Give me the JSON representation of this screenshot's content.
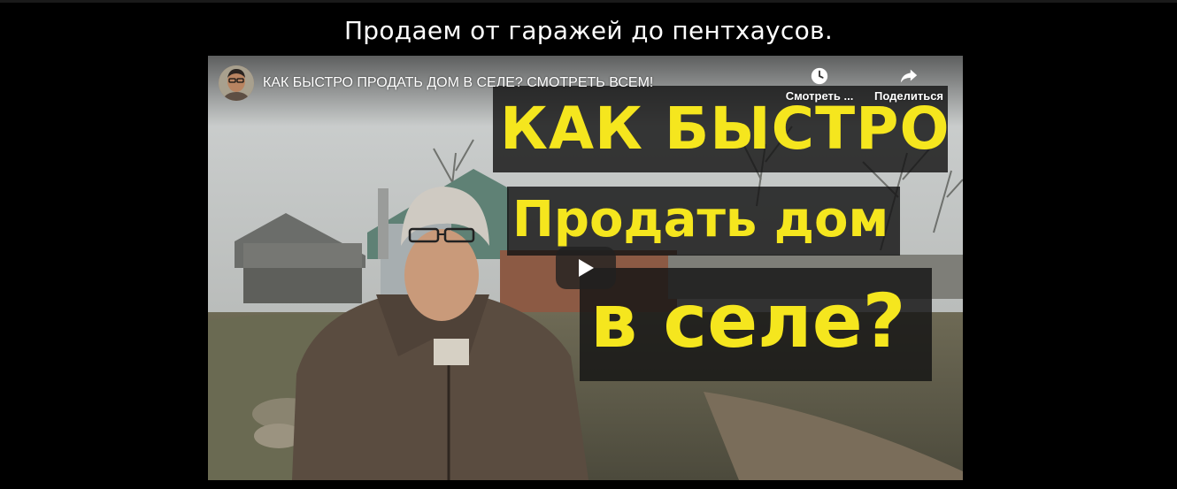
{
  "section": {
    "heading": "Продаем от гаражей до пентхаусов."
  },
  "video": {
    "title": "КАК БЫСТРО ПРОДАТЬ ДОМ В СЕЛЕ? СМОТРЕТЬ ВСЕМ!",
    "watch_later_label": "Смотреть ...",
    "share_label": "Поделиться",
    "thumbnail_text": {
      "line1": "КАК БЫСТРО",
      "line2": "Продать дом",
      "line3": "в селе?"
    }
  },
  "icons": {
    "watch_later": "clock-icon",
    "share": "share-arrow-icon",
    "play": "play-icon",
    "avatar": "channel-avatar"
  },
  "colors": {
    "page_background": "#000000",
    "thumbnail_text": "#f5e61e",
    "play_button_bg": "#212121"
  }
}
